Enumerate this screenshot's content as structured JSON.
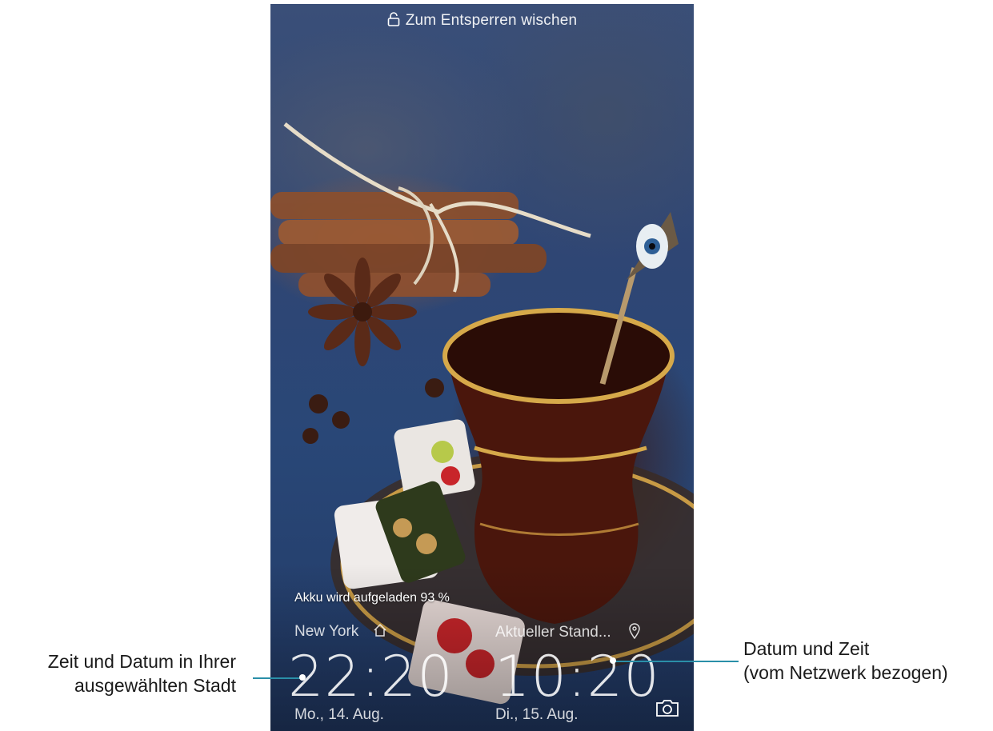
{
  "lockscreen": {
    "unlock_hint": "Zum Entsperren wischen",
    "charging_status": "Akku wird aufgeladen 93 %",
    "home_clock": {
      "city": "New York",
      "time": "22:20",
      "date": "Mo., 14. Aug."
    },
    "local_clock": {
      "city": "Aktueller Stand...",
      "time": "10:20",
      "date": "Di., 15. Aug."
    }
  },
  "annotations": {
    "left_line1": "Zeit und Datum in Ihrer",
    "left_line2": "ausgewählten Stadt",
    "right_line1": "Datum und Zeit",
    "right_line2": "(vom Netzwerk bezogen)"
  },
  "colors": {
    "callout_line": "#2a8fa8",
    "wallpaper_blue": "#2f4674"
  }
}
